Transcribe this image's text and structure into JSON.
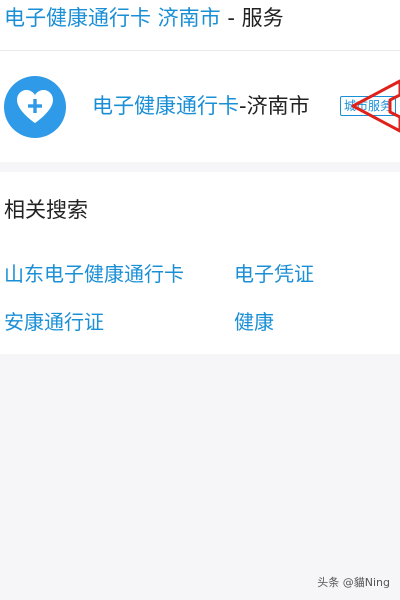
{
  "result": {
    "title_link": "电子健康通行卡 济南市",
    "title_suffix": " - 服务"
  },
  "service": {
    "name_part1": "电子健康通行卡",
    "name_part2": "-济南市",
    "badge": "城市服务",
    "icon": "heart-plus-icon",
    "accent_color": "#2f9ae8"
  },
  "related": {
    "heading": "相关搜索",
    "items": [
      "山东电子健康通行卡",
      "电子凭证",
      "安康通行证",
      "健康"
    ]
  },
  "watermark": "头条 @貓Ning"
}
